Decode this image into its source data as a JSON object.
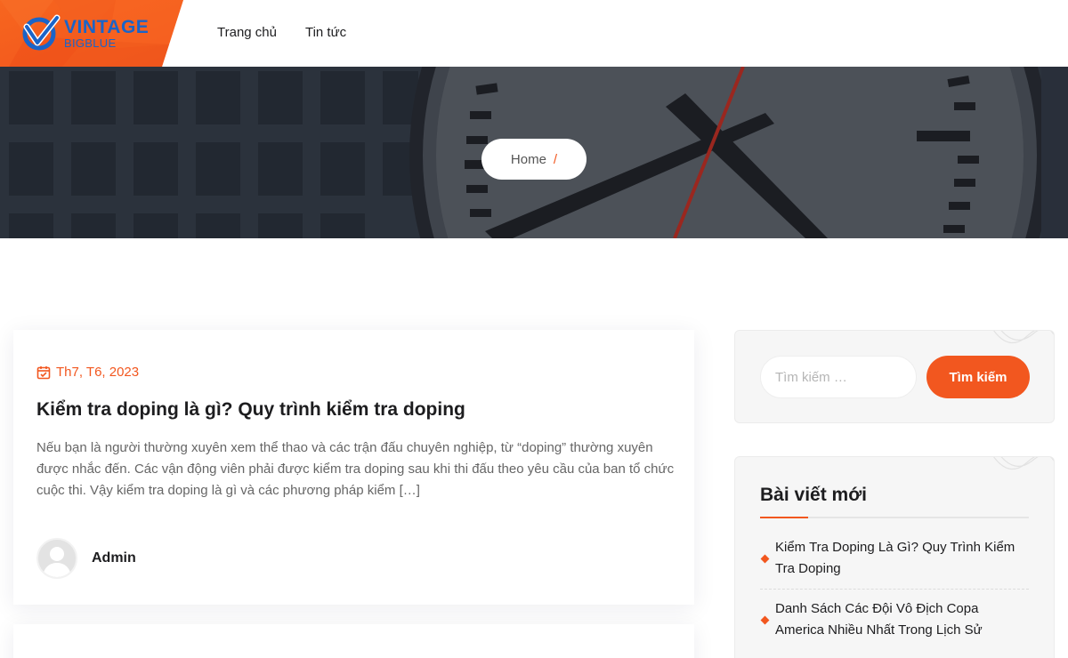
{
  "header": {
    "logo_title": "VINTAGE",
    "logo_sub": "BIGBLUE",
    "nav": [
      {
        "label": "Trang chủ"
      },
      {
        "label": "Tin tức"
      }
    ]
  },
  "hero": {
    "breadcrumb_home": "Home",
    "breadcrumb_sep": "/"
  },
  "post": {
    "date": "Th7, T6, 2023",
    "title": "Kiểm tra doping là gì? Quy trình kiểm tra doping",
    "excerpt": "Nếu bạn là người thường xuyên xem thể thao và các trận đấu chuyên nghiệp, từ “doping” thường xuyên được nhắc đến. Các vận động viên phải được kiểm tra doping sau khi thi đấu theo yêu cầu của ban tổ chức cuộc thi. Vậy kiểm tra doping là gì và các phương pháp kiểm […]",
    "author": "Admin"
  },
  "sidebar": {
    "search": {
      "placeholder": "Tìm kiếm …",
      "button": "Tìm kiếm"
    },
    "recent": {
      "title": "Bài viết mới",
      "items": [
        {
          "label": "Kiểm Tra Doping Là Gì? Quy Trình Kiểm Tra Doping"
        },
        {
          "label": "Danh Sách Các Đội Vô Địch Copa America Nhiều Nhất Trong Lịch Sử"
        }
      ]
    }
  },
  "colors": {
    "accent": "#f2571f",
    "brand_blue": "#1a64c8"
  }
}
